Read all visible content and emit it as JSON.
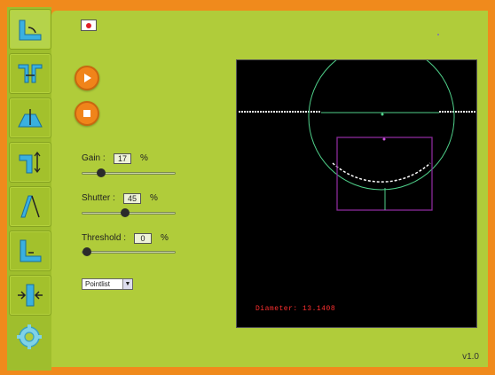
{
  "sidebar": {
    "items": [
      {
        "icon": "measure-angle-icon",
        "selected": true
      },
      {
        "icon": "measure-gap-icon"
      },
      {
        "icon": "measure-height-icon"
      },
      {
        "icon": "measure-step-icon"
      },
      {
        "icon": "measure-taper-icon"
      },
      {
        "icon": "measure-corner-icon"
      },
      {
        "icon": "measure-offset-icon"
      },
      {
        "icon": "settings-gear-icon"
      }
    ]
  },
  "controls": {
    "gain": {
      "label": "Gain :",
      "value": "17",
      "unit": "%",
      "level": 0.17
    },
    "shutter": {
      "label": "Shutter :",
      "value": "45",
      "unit": "%",
      "level": 0.45
    },
    "threshold": {
      "label": "Threshold :",
      "value": "0",
      "unit": "%",
      "level": 0.0
    },
    "mode_select": {
      "selected": "Pointlist"
    }
  },
  "view": {
    "readout": "Diameter: 13.1408"
  },
  "footer": {
    "version": "v1.0"
  },
  "colors": {
    "frame": "#f08a1c",
    "panel": "#b0cc3a",
    "circle": "#4fd08a",
    "roi": "#8a2a9a",
    "readout": "#ff3030"
  }
}
